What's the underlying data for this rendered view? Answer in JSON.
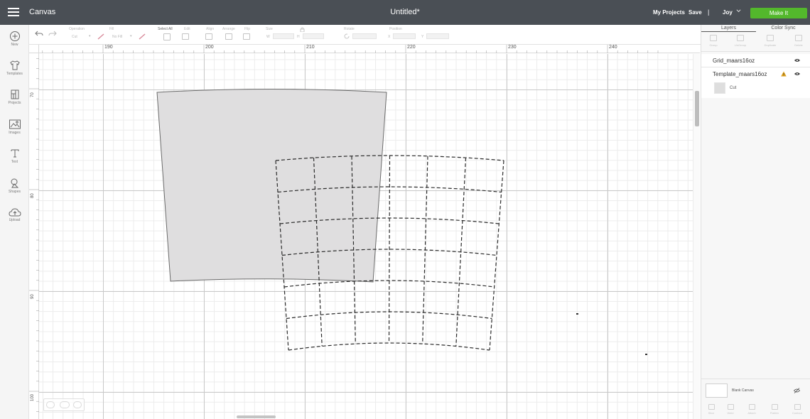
{
  "header": {
    "app_title": "Canvas",
    "doc_title": "Untitled*",
    "my_projects": "My Projects",
    "save": "Save",
    "separator": "|",
    "user": "Joy",
    "make_it": "Make It",
    "make_it_color": "#53b82c",
    "bar_color": "#4a4f55"
  },
  "toolbar": {
    "operation_label": "Operation",
    "operation_value": "Cut",
    "fill_label": "Fill",
    "fill_value": "No Fill",
    "select_all": "Select All",
    "edit": "Edit",
    "align": "Align",
    "arrange": "Arrange",
    "flip": "Flip",
    "size": "Size",
    "size_w": "W",
    "size_h": "H",
    "rotate": "Rotate",
    "position": "Position",
    "pos_x": "X",
    "pos_y": "Y"
  },
  "sidebar": {
    "items": [
      {
        "label": "New",
        "icon": "plus-circle-icon"
      },
      {
        "label": "Templates",
        "icon": "tshirt-icon"
      },
      {
        "label": "Projects",
        "icon": "projects-icon"
      },
      {
        "label": "Images",
        "icon": "image-icon"
      },
      {
        "label": "Text",
        "icon": "text-icon"
      },
      {
        "label": "Shapes",
        "icon": "shapes-icon"
      },
      {
        "label": "Upload",
        "icon": "upload-cloud-icon"
      }
    ]
  },
  "ruler": {
    "h_labels": [
      "190",
      "200",
      "210",
      "220",
      "230",
      "240"
    ],
    "v_labels": [
      "70",
      "80",
      "90",
      "100"
    ]
  },
  "right_panel": {
    "tabs": [
      "Layers",
      "Color Sync"
    ],
    "active_tab": "Layers",
    "tools": [
      "Group",
      "UnGroup",
      "Duplicate",
      "Delete"
    ],
    "layers": [
      {
        "name": "Grid_maars16oz",
        "expanded": false,
        "warning": false
      },
      {
        "name": "Template_maars16oz",
        "expanded": true,
        "warning": true
      }
    ],
    "sub_layer": {
      "name": "Cut",
      "swatch_color": "#dedede"
    },
    "blank_canvas": "Blank Canvas",
    "bottom_tools": [
      "Slice",
      "Weld",
      "Attach",
      "Flatten",
      "Contour"
    ]
  }
}
